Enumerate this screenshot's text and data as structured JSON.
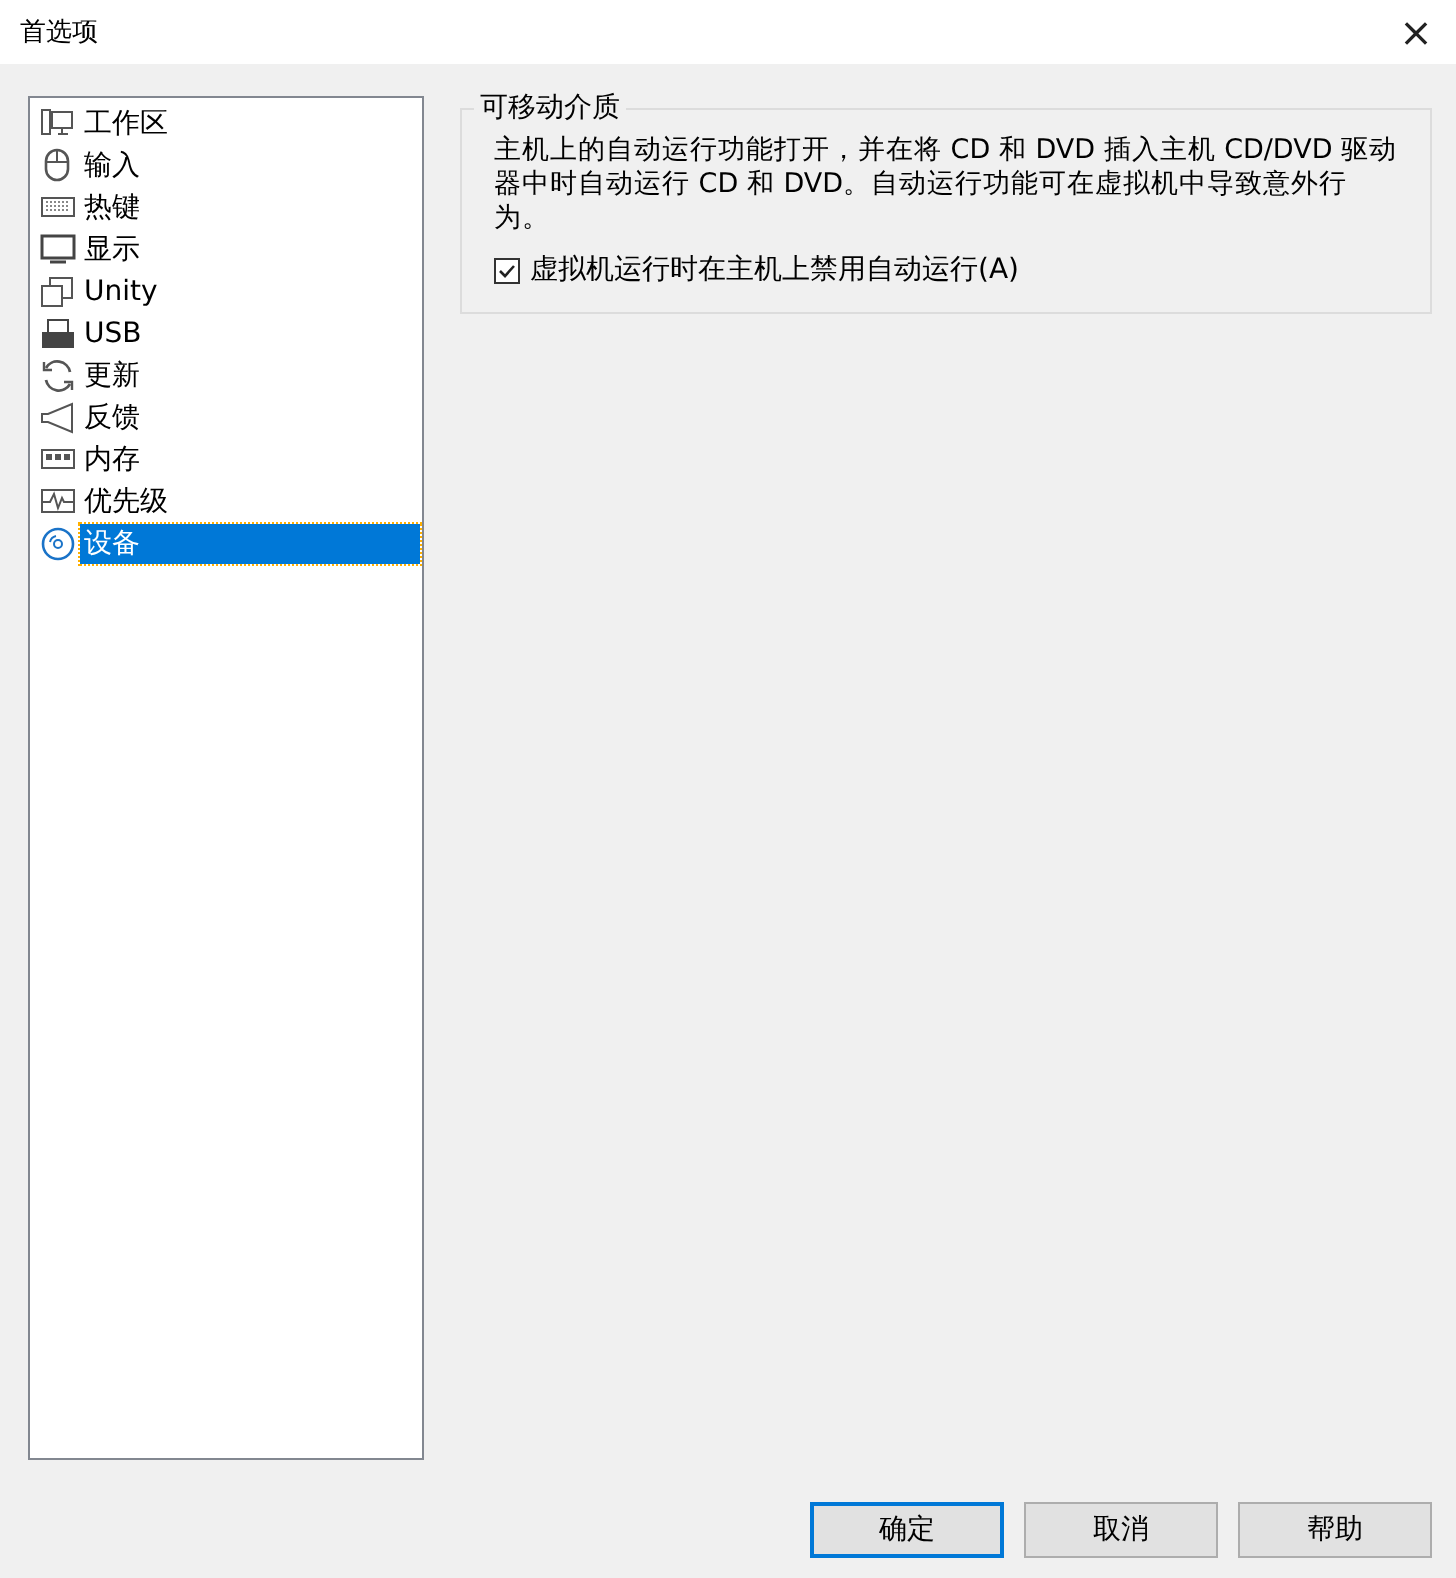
{
  "window": {
    "title": "首选项",
    "close": "×"
  },
  "sidebar": {
    "items": [
      {
        "label": "工作区",
        "selected": false
      },
      {
        "label": "输入",
        "selected": false
      },
      {
        "label": "热键",
        "selected": false
      },
      {
        "label": "显示",
        "selected": false
      },
      {
        "label": "Unity",
        "selected": false
      },
      {
        "label": "USB",
        "selected": false
      },
      {
        "label": "更新",
        "selected": false
      },
      {
        "label": "反馈",
        "selected": false
      },
      {
        "label": "内存",
        "selected": false
      },
      {
        "label": "优先级",
        "selected": false
      },
      {
        "label": "设备",
        "selected": true
      }
    ]
  },
  "group": {
    "title": "可移动介质",
    "description": "主机上的自动运行功能打开，并在将 CD 和 DVD 插入主机 CD/DVD 驱动器中时自动运行 CD 和 DVD。自动运行功能可在虚拟机中导致意外行为。",
    "checkbox": {
      "label": "虚拟机运行时在主机上禁用自动运行(A)",
      "checked": true
    }
  },
  "buttons": [
    {
      "label": "确定",
      "default": true
    },
    {
      "label": "取消",
      "default": false
    },
    {
      "label": "帮助",
      "default": false
    }
  ]
}
